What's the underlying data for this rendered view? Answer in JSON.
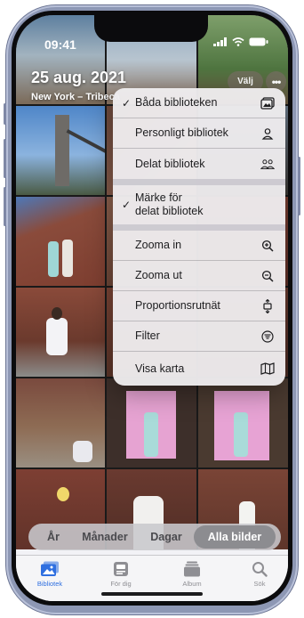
{
  "status": {
    "time": "09:41"
  },
  "header": {
    "date": "25 aug. 2021",
    "place": "New York – Tribeca",
    "select_label": "Välj",
    "more_label": "•••"
  },
  "menu": {
    "items": [
      {
        "label": "Båda biblioteken",
        "checked": true,
        "icon": "library-stack-icon"
      },
      {
        "label": "Personligt bibliotek",
        "checked": false,
        "icon": "person-icon"
      },
      {
        "label": "Delat bibliotek",
        "checked": false,
        "icon": "people-icon"
      },
      {
        "label_line1": "Märke för",
        "label_line2": "delat bibliotek",
        "checked": true
      },
      {
        "label": "Zooma in",
        "checked": false,
        "icon": "zoom-in-icon"
      },
      {
        "label": "Zooma ut",
        "checked": false,
        "icon": "zoom-out-icon"
      },
      {
        "label": "Proportionsrutnät",
        "checked": false,
        "icon": "aspect-grid-icon"
      },
      {
        "label": "Filter",
        "checked": false,
        "icon": "filter-icon"
      },
      {
        "label": "Visa karta",
        "checked": false,
        "icon": "map-icon"
      }
    ],
    "check_glyph": "✓"
  },
  "segmented": {
    "items": [
      "År",
      "Månader",
      "Dagar",
      "Alla bilder"
    ],
    "selected": "Alla bilder"
  },
  "tabs": [
    {
      "label": "Bibliotek",
      "icon": "photo-library-icon",
      "active": true
    },
    {
      "label": "För dig",
      "icon": "for-you-icon",
      "active": false
    },
    {
      "label": "Album",
      "icon": "album-icon",
      "active": false
    },
    {
      "label": "Sök",
      "icon": "search-icon",
      "active": false
    }
  ],
  "colors": {
    "accent": "#2f6fe0",
    "frame": "#8d97b4"
  }
}
